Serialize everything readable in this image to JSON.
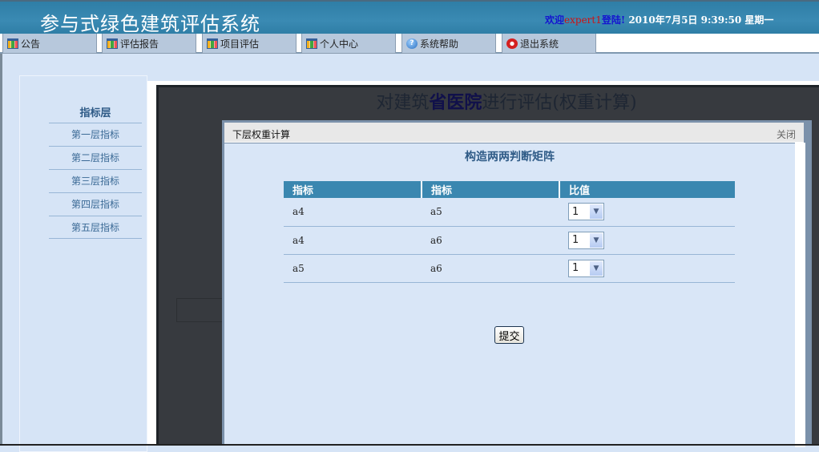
{
  "header": {
    "app_title": "参与式绿色建筑评估系统",
    "welcome": "欢迎",
    "username": "expert1",
    "login_suffix": "登陆!",
    "datetime": " 2010年7月5日  9:39:50 星期一"
  },
  "nav": [
    {
      "label": "公告",
      "icon": "chart-icon"
    },
    {
      "label": "评估报告",
      "icon": "chart-icon"
    },
    {
      "label": "项目评估",
      "icon": "chart-icon"
    },
    {
      "label": "个人中心",
      "icon": "chart-icon"
    },
    {
      "label": "系统帮助",
      "icon": "help-icon"
    },
    {
      "label": "退出系统",
      "icon": "exit-icon"
    }
  ],
  "sidebar": {
    "title": "指标层",
    "items": [
      "第一层指标",
      "第二层指标",
      "第三层指标",
      "第四层指标",
      "第五层指标"
    ]
  },
  "page": {
    "heading_pre": "对建筑",
    "building": "省医院",
    "heading_post": "进行评估(权重计算)"
  },
  "modal": {
    "title": "下层权重计算",
    "close": "关闭",
    "body_title": "构造两两判断矩阵",
    "columns": [
      "指标",
      "指标",
      "比值"
    ],
    "rows": [
      [
        "a4",
        "a5",
        "1"
      ],
      [
        "a4",
        "a6",
        "1"
      ],
      [
        "a5",
        "a6",
        "1"
      ]
    ],
    "submit": "提交"
  },
  "colors": {
    "header": "#3a8ab3",
    "table_header": "#3a87b0",
    "overlay": "#373a3f",
    "page_bg": "#d6e4f6"
  }
}
